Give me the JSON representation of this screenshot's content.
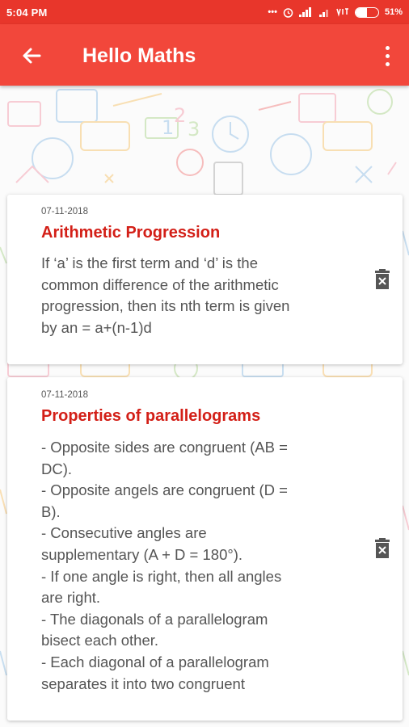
{
  "status_bar": {
    "time": "5:04 PM",
    "indicators": [
      "...",
      "alarm-icon",
      "signal-icon",
      "signal-icon-2",
      "volte-icon"
    ],
    "battery_percent_label": "51%",
    "battery_level": 0.51
  },
  "app_bar": {
    "title": "Hello Maths",
    "back_icon": "arrow-left-icon",
    "menu_icon": "more-vert-icon"
  },
  "notes": [
    {
      "date": "07-11-2018",
      "title": "Arithmetic Progression",
      "body": "If ‘a’ is the first term and ‘d’ is the\ncommon difference of the arithmetic\nprogression, then its nth term is given\nby an = a+(n-1)d",
      "delete_icon": "delete-icon"
    },
    {
      "date": "07-11-2018",
      "title": "Properties of parallelograms",
      "body": "- Opposite sides are congruent (AB =\nDC).\n- Opposite angels are congruent (D =\nB).\n- Consecutive angles are\nsupplementary (A + D = 180°).\n- If one angle is right, then all angles\nare right.\n- The diagonals of a parallelogram\nbisect each other.\n- Each diagonal of a parallelogram\nseparates it into two congruent",
      "delete_icon": "delete-icon"
    }
  ],
  "colors": {
    "status_bar": "#e8362b",
    "app_bar": "#f2473b",
    "title_red": "#d31f17"
  }
}
